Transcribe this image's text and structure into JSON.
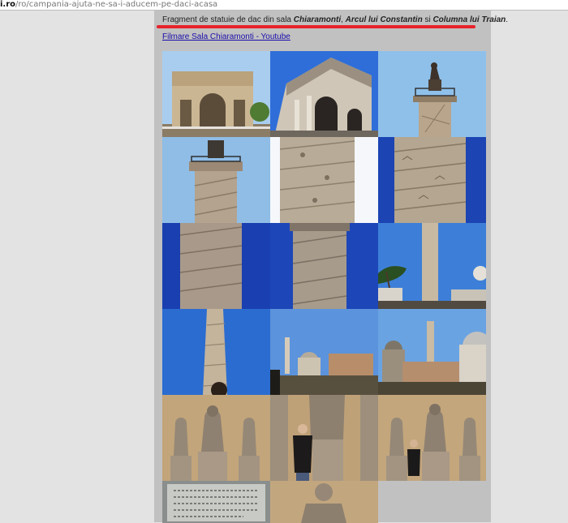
{
  "browser": {
    "url_domain": "i.ro",
    "url_path": "/ro/campania-ajuta-ne-sa-i-aducem-pe-daci-acasa"
  },
  "article": {
    "caption_prefix": "Fragment de statuie de dac din sala ",
    "caption_place1": "Chiaramonti",
    "caption_sep1": ", ",
    "caption_place2": "Arcul lui Constantin",
    "caption_sep2": " si ",
    "caption_place3": "Columna lui Traian",
    "caption_end": ".",
    "youtube_link": "Filmare Sala Chiaramonti - Youtube"
  },
  "annotation": {
    "underline_color": "#e8222b"
  },
  "gallery": {
    "photos": [
      {
        "subject": "arch-of-constantin-photo"
      },
      {
        "subject": "arch-of-constantin-closeup-photo"
      },
      {
        "subject": "trajan-column-top-statue-photo"
      },
      {
        "subject": "trajan-column-capital-photo"
      },
      {
        "subject": "trajan-column-relief-closeup-photo"
      },
      {
        "subject": "trajan-column-relief-photo"
      },
      {
        "subject": "trajan-column-shaft-photo"
      },
      {
        "subject": "trajan-column-shaft-detail-photo"
      },
      {
        "subject": "trajan-column-pines-photo"
      },
      {
        "subject": "trajan-column-low-angle-photo"
      },
      {
        "subject": "trajan-forum-churches-photo"
      },
      {
        "subject": "trajan-forum-panorama-photo"
      },
      {
        "subject": "dacian-statues-hall-photo"
      },
      {
        "subject": "dacian-statue-with-visitor-photo"
      },
      {
        "subject": "dacian-statues-visitor-photo"
      },
      {
        "subject": "inscription-plaque-photo"
      },
      {
        "subject": "dacian-statue-bust-photo"
      }
    ]
  }
}
